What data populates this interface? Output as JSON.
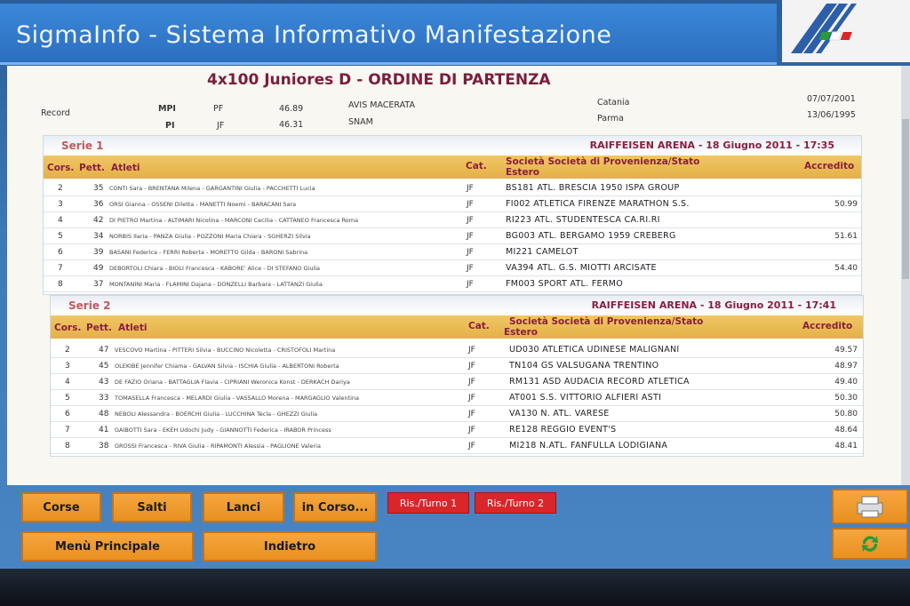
{
  "app": {
    "title": "SigmaInfo - Sistema Informativo Manifestazione"
  },
  "event": {
    "title": "4x100 Juniores D - ORDINE DI PARTENZA"
  },
  "records": {
    "label": "Record",
    "rows": [
      {
        "type": "MPI",
        "cat": "PF",
        "time": "46.89",
        "club": "AVIS MACERATA",
        "place": "Catania",
        "date": "07/07/2001"
      },
      {
        "type": "PI",
        "cat": "JF",
        "time": "46.31",
        "club": "SNAM",
        "place": "Parma",
        "date": "13/06/1995"
      }
    ]
  },
  "columns": {
    "cors": "Cors.",
    "pett": "Pett.",
    "atleti": "Atleti",
    "cat": "Cat.",
    "societa_line1": "Società Società di Provenienza/Stato",
    "societa_line2": "Estero",
    "accredito": "Accredito"
  },
  "series": [
    {
      "label": "Serie 1",
      "venue": "RAIFFEISEN ARENA - 18 Giugno 2011 - 17:35",
      "rows": [
        {
          "cors": "2",
          "pett": "35",
          "atleti": "CONTI Sara - BRENTANA Milena - GARGANTINI Giulia - PACCHETTI Lucia",
          "cat": "JF",
          "soc": "BS181 ATL. BRESCIA 1950 ISPA GROUP",
          "acc": ""
        },
        {
          "cors": "3",
          "pett": "36",
          "atleti": "ORSI Gianna - OSSENI Diletta - MANETTI Noemi - BARACANI Sara",
          "cat": "JF",
          "soc": "FI002 ATLETICA FIRENZE MARATHON S.S.",
          "acc": "50.99"
        },
        {
          "cors": "4",
          "pett": "42",
          "atleti": "DI PIETRO Martina - ALTIMARI Nicolina - MARCONI Cecilia - CATTANEO Francesca Roma",
          "cat": "JF",
          "soc": "RI223 ATL. STUDENTESCA CA.RI.RI",
          "acc": ""
        },
        {
          "cors": "5",
          "pett": "34",
          "atleti": "NORBIS Ilaria - PANZA Giulia - POZZONI Maria Chiara - SGHERZI Silvia",
          "cat": "JF",
          "soc": "BG003 ATL. BERGAMO 1959 CREBERG",
          "acc": "51.61"
        },
        {
          "cors": "6",
          "pett": "39",
          "atleti": "BASANI Federica - FERRI Roberta - MORETTO Gilda - BARONI Sabrina",
          "cat": "JF",
          "soc": "MI221 CAMELOT",
          "acc": ""
        },
        {
          "cors": "7",
          "pett": "49",
          "atleti": "DEBORTOLI Chiara - BIOLI Francesca - KABORE' Alice - DI STEFANO Giulia",
          "cat": "JF",
          "soc": "VA394 ATL. G.S. MIOTTI ARCISATE",
          "acc": "54.40"
        },
        {
          "cors": "8",
          "pett": "37",
          "atleti": "MONTANINI Maria - FLAMINI Dajana - DONZELLI Barbara - LATTANZI Giulia",
          "cat": "JF",
          "soc": "FM003 SPORT ATL. FERMO",
          "acc": ""
        }
      ]
    },
    {
      "label": "Serie 2",
      "venue": "RAIFFEISEN ARENA - 18 Giugno 2011 - 17:41",
      "rows": [
        {
          "cors": "2",
          "pett": "47",
          "atleti": "VESCOVO Martina - PITTERI Silvia - BUCCINO Nicoletta - CRISTOFOLI Martina",
          "cat": "JF",
          "soc": "UD030 ATLETICA UDINESE MALIGNANI",
          "acc": "49.57"
        },
        {
          "cors": "3",
          "pett": "45",
          "atleti": "OLEKIBE Jennifer Chiama - GALVAN Silvia - ISCHIA Giulia - ALBERTONI Roberta",
          "cat": "JF",
          "soc": "TN104 GS VALSUGANA TRENTINO",
          "acc": "48.97"
        },
        {
          "cors": "4",
          "pett": "43",
          "atleti": "DE FAZIO Oriana - BATTAGLIA Flavia - CIPRIANI Weronica Konst - DERKACH Dariya",
          "cat": "JF",
          "soc": "RM131 ASD AUDACIA RECORD ATLETICA",
          "acc": "49.40"
        },
        {
          "cors": "5",
          "pett": "33",
          "atleti": "TOMASELLA Francesca - MELARDI Giulia - VASSALLO Morena - MARGAGLIO Valentina",
          "cat": "JF",
          "soc": "AT001 S.S. VITTORIO ALFIERI ASTI",
          "acc": "50.30"
        },
        {
          "cors": "6",
          "pett": "48",
          "atleti": "NEBOLI Alessandra - BOERCHI Giulia - LUCCHINA Tecla - GHEZZI Giulia",
          "cat": "JF",
          "soc": "VA130 N. ATL. VARESE",
          "acc": "50.80"
        },
        {
          "cors": "7",
          "pett": "41",
          "atleti": "GAIBOTTI Sara - EKEH Udochi Judy - GIANNOTTI Federica - IRABOR Princess",
          "cat": "JF",
          "soc": "RE128 REGGIO EVENT'S",
          "acc": "48.64"
        },
        {
          "cors": "8",
          "pett": "38",
          "atleti": "GROSSI Francesca - RIVA Giulia - RIPAMONTI Alessia - PAGLIONE Valeria",
          "cat": "JF",
          "soc": "MI218 N.ATL. FANFULLA LODIGIANA",
          "acc": "48.41"
        }
      ]
    }
  ],
  "buttons": {
    "corse": "Corse",
    "salti": "Salti",
    "lanci": "Lanci",
    "in_corso": "in Corso...",
    "ris_turno_1": "Ris./Turno 1",
    "ris_turno_2": "Ris./Turno 2",
    "menu_principale": "Menù Principale",
    "indietro": "Indietro"
  },
  "icons": {
    "print": "printer-icon",
    "refresh": "refresh-icon",
    "logo": "federation-logo"
  },
  "colors": {
    "title_bar": "#2c6ec0",
    "button_orange": "#e8901f",
    "header_gold": "#e4b048",
    "accent_maroon": "#8b1e3f",
    "button_red": "#d8262a"
  }
}
